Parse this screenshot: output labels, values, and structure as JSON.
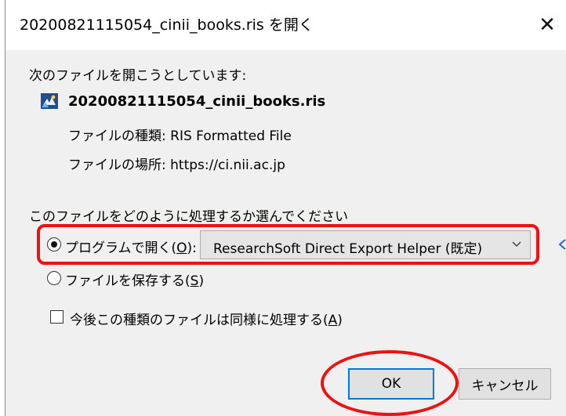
{
  "dialog": {
    "title": "20200821115054_cinii_books.ris を開く",
    "intro": "次のファイルを開こうとしています:",
    "filename": "20200821115054_cinii_books.ris",
    "file_type_label": "ファイルの種類:",
    "file_type_value": "RIS Formatted File",
    "file_location_label": "ファイルの場所:",
    "file_location_value": "https://ci.nii.ac.jp",
    "section_label": "このファイルをどのように処理するか選んでください",
    "open_with": {
      "label": "プログラムで開く(",
      "accel": "O",
      "label_end": "):",
      "selected": true,
      "program": "ResearchSoft Direct Export Helper (既定)"
    },
    "save_file": {
      "label": "ファイルを保存する(",
      "accel": "S",
      "label_end": ")",
      "selected": false
    },
    "remember": {
      "label": "今後この種類のファイルは同様に処理する(",
      "accel": "A",
      "label_end": ")",
      "checked": false
    },
    "ok_label": "OK",
    "cancel_label": "キャンセル",
    "close_symbol": "✕"
  },
  "colors": {
    "highlight": "#ee1111",
    "focus_border": "#0078d7",
    "dialog_bg": "#f0f0f0"
  },
  "icons": [
    "close-icon",
    "ris-file-icon",
    "chevron-down-icon",
    "arrow-left-icon"
  ]
}
